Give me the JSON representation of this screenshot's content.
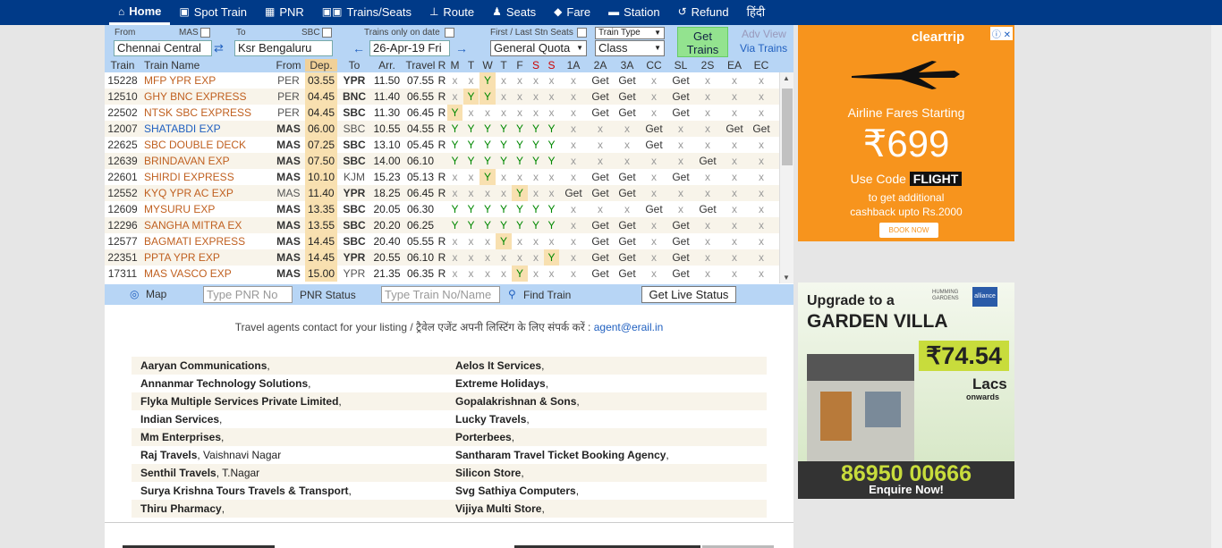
{
  "nav": [
    {
      "icon": "home-icon",
      "glyph": "⌂",
      "label": "Home",
      "active": true
    },
    {
      "icon": "train-icon",
      "glyph": "▣",
      "label": "Spot Train"
    },
    {
      "icon": "pnr-icon",
      "glyph": "▦",
      "label": "PNR"
    },
    {
      "icon": "trains-seats-icon",
      "glyph": "▣▣",
      "label": "Trains/Seats"
    },
    {
      "icon": "route-icon",
      "glyph": "⊥",
      "label": "Route"
    },
    {
      "icon": "seats-icon",
      "glyph": "♟",
      "label": "Seats"
    },
    {
      "icon": "fare-icon",
      "glyph": "◆",
      "label": "Fare"
    },
    {
      "icon": "station-icon",
      "glyph": "▬",
      "label": "Station"
    },
    {
      "icon": "refund-icon",
      "glyph": "↺",
      "label": "Refund"
    },
    {
      "icon": "",
      "glyph": "",
      "label": "हिंदी"
    }
  ],
  "filter": {
    "from_label": "From",
    "from_code": "MAS",
    "from_value": "Chennai Central",
    "to_label": "To",
    "to_code": "SBC",
    "to_value": "Ksr Bengaluru",
    "trains_only_label": "Trains only on date",
    "date_value": "26-Apr-19 Fri",
    "first_last_label": "First / Last Stn Seats",
    "quota_value": "General Quota",
    "train_type_value": "Train Type",
    "class_value": "Class",
    "get_trains_label": "Get Trains",
    "adv_view_label": "Adv View",
    "via_trains_label": "Via Trains"
  },
  "columns": [
    "Train",
    "Train Name",
    "From",
    "Dep.",
    "To",
    "Arr.",
    "Travel",
    "R",
    "M",
    "T",
    "W",
    "T",
    "F",
    "S",
    "S",
    "1A",
    "2A",
    "3A",
    "CC",
    "SL",
    "2S",
    "EA",
    "EC"
  ],
  "trains": [
    {
      "no": "15228",
      "name": "MFP YPR EXP",
      "from": "PER",
      "dep": "03.55",
      "to": "YPR",
      "arr": "11.50",
      "travel": "07.55",
      "r": "R",
      "days": [
        "x",
        "x",
        "Y",
        "x",
        "x",
        "x",
        "x"
      ],
      "cls": [
        "x",
        "Get",
        "Get",
        "x",
        "Get",
        "x",
        "x",
        "x"
      ],
      "blue": false,
      "fb": false,
      "tb": true
    },
    {
      "no": "12510",
      "name": "GHY BNC EXPRESS",
      "from": "PER",
      "dep": "04.45",
      "to": "BNC",
      "arr": "11.40",
      "travel": "06.55",
      "r": "R",
      "days": [
        "x",
        "Y",
        "Y",
        "x",
        "x",
        "x",
        "x"
      ],
      "cls": [
        "x",
        "Get",
        "Get",
        "x",
        "Get",
        "x",
        "x",
        "x"
      ],
      "blue": false,
      "fb": false,
      "tb": true
    },
    {
      "no": "22502",
      "name": "NTSK SBC EXPRESS",
      "from": "PER",
      "dep": "04.45",
      "to": "SBC",
      "arr": "11.30",
      "travel": "06.45",
      "r": "R",
      "days": [
        "Y",
        "x",
        "x",
        "x",
        "x",
        "x",
        "x"
      ],
      "cls": [
        "x",
        "Get",
        "Get",
        "x",
        "Get",
        "x",
        "x",
        "x"
      ],
      "blue": false,
      "fb": false,
      "tb": true
    },
    {
      "no": "12007",
      "name": "SHATABDI EXP",
      "from": "MAS",
      "dep": "06.00",
      "to": "SBC",
      "arr": "10.55",
      "travel": "04.55",
      "r": "R",
      "days": [
        "Y",
        "Y",
        "Y",
        "Y",
        "Y",
        "Y",
        "Y"
      ],
      "cls": [
        "x",
        "x",
        "x",
        "Get",
        "x",
        "x",
        "Get",
        "Get"
      ],
      "blue": true,
      "fb": true,
      "tb": false
    },
    {
      "no": "22625",
      "name": "SBC DOUBLE DECK",
      "from": "MAS",
      "dep": "07.25",
      "to": "SBC",
      "arr": "13.10",
      "travel": "05.45",
      "r": "R",
      "days": [
        "Y",
        "Y",
        "Y",
        "Y",
        "Y",
        "Y",
        "Y"
      ],
      "cls": [
        "x",
        "x",
        "x",
        "Get",
        "x",
        "x",
        "x",
        "x"
      ],
      "blue": false,
      "fb": true,
      "tb": true
    },
    {
      "no": "12639",
      "name": "BRINDAVAN EXP",
      "from": "MAS",
      "dep": "07.50",
      "to": "SBC",
      "arr": "14.00",
      "travel": "06.10",
      "r": "",
      "days": [
        "Y",
        "Y",
        "Y",
        "Y",
        "Y",
        "Y",
        "Y"
      ],
      "cls": [
        "x",
        "x",
        "x",
        "x",
        "x",
        "Get",
        "x",
        "x"
      ],
      "blue": false,
      "fb": true,
      "tb": true
    },
    {
      "no": "22601",
      "name": "SHIRDI EXPRESS",
      "from": "MAS",
      "dep": "10.10",
      "to": "KJM",
      "arr": "15.23",
      "travel": "05.13",
      "r": "R",
      "days": [
        "x",
        "x",
        "Y",
        "x",
        "x",
        "x",
        "x"
      ],
      "cls": [
        "x",
        "Get",
        "Get",
        "x",
        "Get",
        "x",
        "x",
        "x"
      ],
      "blue": false,
      "fb": true,
      "tb": false
    },
    {
      "no": "12552",
      "name": "KYQ YPR AC EXP",
      "from": "MAS",
      "dep": "11.40",
      "to": "YPR",
      "arr": "18.25",
      "travel": "06.45",
      "r": "R",
      "days": [
        "x",
        "x",
        "x",
        "x",
        "Y",
        "x",
        "x"
      ],
      "cls": [
        "Get",
        "Get",
        "Get",
        "x",
        "x",
        "x",
        "x",
        "x"
      ],
      "blue": false,
      "fb": false,
      "tb": true
    },
    {
      "no": "12609",
      "name": "MYSURU EXP",
      "from": "MAS",
      "dep": "13.35",
      "to": "SBC",
      "arr": "20.05",
      "travel": "06.30",
      "r": "",
      "days": [
        "Y",
        "Y",
        "Y",
        "Y",
        "Y",
        "Y",
        "Y"
      ],
      "cls": [
        "x",
        "x",
        "x",
        "Get",
        "x",
        "Get",
        "x",
        "x"
      ],
      "blue": false,
      "fb": true,
      "tb": true
    },
    {
      "no": "12296",
      "name": "SANGHA MITRA EX",
      "from": "MAS",
      "dep": "13.55",
      "to": "SBC",
      "arr": "20.20",
      "travel": "06.25",
      "r": "",
      "days": [
        "Y",
        "Y",
        "Y",
        "Y",
        "Y",
        "Y",
        "Y"
      ],
      "cls": [
        "x",
        "Get",
        "Get",
        "x",
        "Get",
        "x",
        "x",
        "x"
      ],
      "blue": false,
      "fb": true,
      "tb": true
    },
    {
      "no": "12577",
      "name": "BAGMATI EXPRESS",
      "from": "MAS",
      "dep": "14.45",
      "to": "SBC",
      "arr": "20.40",
      "travel": "05.55",
      "r": "R",
      "days": [
        "x",
        "x",
        "x",
        "Y",
        "x",
        "x",
        "x"
      ],
      "cls": [
        "x",
        "Get",
        "Get",
        "x",
        "Get",
        "x",
        "x",
        "x"
      ],
      "blue": false,
      "fb": true,
      "tb": true
    },
    {
      "no": "22351",
      "name": "PPTA YPR EXP",
      "from": "MAS",
      "dep": "14.45",
      "to": "YPR",
      "arr": "20.55",
      "travel": "06.10",
      "r": "R",
      "days": [
        "x",
        "x",
        "x",
        "x",
        "x",
        "x",
        "Y"
      ],
      "cls": [
        "x",
        "Get",
        "Get",
        "x",
        "Get",
        "x",
        "x",
        "x"
      ],
      "blue": false,
      "fb": true,
      "tb": true
    },
    {
      "no": "17311",
      "name": "MAS VASCO EXP",
      "from": "MAS",
      "dep": "15.00",
      "to": "YPR",
      "arr": "21.35",
      "travel": "06.35",
      "r": "R",
      "days": [
        "x",
        "x",
        "x",
        "x",
        "Y",
        "x",
        "x"
      ],
      "cls": [
        "x",
        "Get",
        "Get",
        "x",
        "Get",
        "x",
        "x",
        "x"
      ],
      "blue": false,
      "fb": true,
      "tb": false
    }
  ],
  "bottombar": {
    "map_label": "Map",
    "pnr_placeholder": "Type PNR No",
    "pnr_status_label": "PNR Status",
    "train_placeholder": "Type Train No/Name",
    "find_train_label": "Find Train",
    "live_status_label": "Get Live Status"
  },
  "agent_text": "Travel agents contact for your listing / ट्रैवेल एजेंट अपनी लिस्टिंग के लिए संपर्क करें : ",
  "agent_email": "agent@erail.in",
  "agents": [
    [
      {
        "name": "Aaryan Communications",
        "loc": ","
      },
      {
        "name": "Aelos It Services",
        "loc": ","
      }
    ],
    [
      {
        "name": "Annanmar Technology Solutions",
        "loc": ","
      },
      {
        "name": "Extreme Holidays",
        "loc": ","
      }
    ],
    [
      {
        "name": "Flyka Multiple Services Private Limited",
        "loc": ","
      },
      {
        "name": "Gopalakrishnan & Sons",
        "loc": ","
      }
    ],
    [
      {
        "name": "Indian Services",
        "loc": ","
      },
      {
        "name": "Lucky Travels",
        "loc": ","
      }
    ],
    [
      {
        "name": "Mm Enterprises",
        "loc": ","
      },
      {
        "name": "Porterbees",
        "loc": ","
      }
    ],
    [
      {
        "name": "Raj Travels",
        "loc": ", Vaishnavi Nagar"
      },
      {
        "name": "Santharam Travel Ticket Booking Agency",
        "loc": ","
      }
    ],
    [
      {
        "name": "Senthil Travels",
        "loc": ", T.Nagar"
      },
      {
        "name": "Silicon Store",
        "loc": ","
      }
    ],
    [
      {
        "name": "Surya Krishna Tours Travels & Transport",
        "loc": ","
      },
      {
        "name": "Svg Sathiya Computers",
        "loc": ","
      }
    ],
    [
      {
        "name": "Thiru Pharmacy",
        "loc": ","
      },
      {
        "name": "Vijiya Multi Store",
        "loc": ","
      }
    ]
  ],
  "ad1": {
    "brand": "cleartrip",
    "line1": "Airline Fares Starting",
    "price": "₹699",
    "code_prefix": "Use Code",
    "code": "FLIGHT",
    "line2": "to get additional",
    "line3": "cashback upto Rs.2000",
    "cta": "BOOK NOW",
    "color": "#f7941d"
  },
  "ad2": {
    "line1": "Upgrade to a",
    "line2": "GARDEN VILLA",
    "logo1": "HUMMING GARDENS",
    "logo2": "alliance",
    "price": "₹74.54",
    "unit1": "Lacs",
    "unit2": "onwards",
    "phone": "86950 00666",
    "cta": "Enquire Now!"
  }
}
